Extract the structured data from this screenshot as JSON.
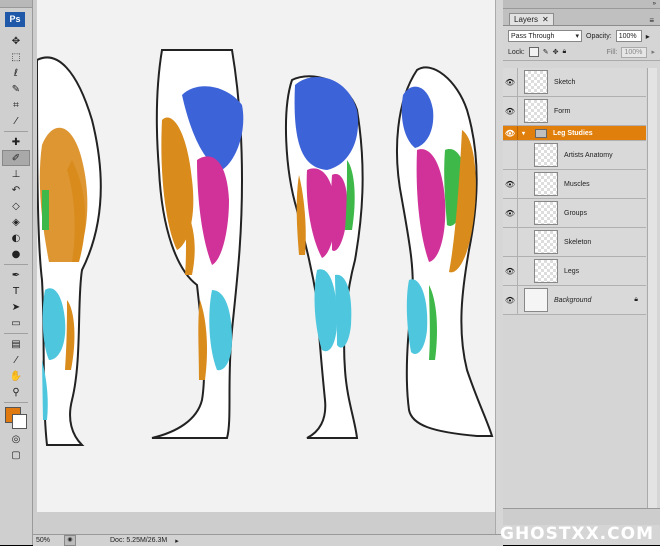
{
  "app": {
    "logo": "Ps"
  },
  "toolbar": {
    "tools": [
      {
        "name": "move-tool",
        "glyph": "✥"
      },
      {
        "name": "marquee-tool",
        "glyph": "⬚"
      },
      {
        "name": "lasso-tool",
        "glyph": "ℓ"
      },
      {
        "name": "quick-select-tool",
        "glyph": "✎"
      },
      {
        "name": "crop-tool",
        "glyph": "⌗"
      },
      {
        "name": "eyedropper-tool",
        "glyph": "⁄"
      },
      {
        "name": "healing-tool",
        "glyph": "✚"
      },
      {
        "name": "brush-tool",
        "glyph": "✐",
        "active": true
      },
      {
        "name": "clone-stamp-tool",
        "glyph": "⊥"
      },
      {
        "name": "history-brush-tool",
        "glyph": "↶"
      },
      {
        "name": "eraser-tool",
        "glyph": "◇"
      },
      {
        "name": "paint-bucket-tool",
        "glyph": "◈"
      },
      {
        "name": "blur-tool",
        "glyph": "◐"
      },
      {
        "name": "dodge-tool",
        "glyph": "●"
      },
      {
        "name": "pen-tool",
        "glyph": "✒"
      },
      {
        "name": "type-tool",
        "glyph": "T"
      },
      {
        "name": "path-select-tool",
        "glyph": "➤"
      },
      {
        "name": "shape-tool",
        "glyph": "▭"
      },
      {
        "name": "notes-tool",
        "glyph": "▤"
      },
      {
        "name": "eyedropper2-tool",
        "glyph": "⁄"
      },
      {
        "name": "hand-tool",
        "glyph": "✋"
      },
      {
        "name": "zoom-tool",
        "glyph": "⚲"
      }
    ],
    "foreground_color": "#e07a10",
    "background_color": "#ffffff",
    "quickmask_glyph": "◎",
    "screenmode_glyph": "▢"
  },
  "status": {
    "zoom": "50%",
    "doc": "Doc: 5.25M/26.3M",
    "arrow": "▸"
  },
  "layers_panel": {
    "tab": "Layers",
    "close": "✕",
    "menu": "≡",
    "collapse": "»",
    "blend_mode": "Pass Through",
    "opacity_label": "Opacity:",
    "opacity_value": "100%",
    "lock_label": "Lock:",
    "fill_label": "Fill:",
    "fill_value": "100%",
    "layers": [
      {
        "name": "Sketch",
        "visible": true,
        "type": "layer"
      },
      {
        "name": "Form",
        "visible": true,
        "type": "layer"
      },
      {
        "name": "Leg Studies",
        "visible": true,
        "type": "group"
      },
      {
        "name": "Artists Anatomy",
        "visible": false,
        "type": "child"
      },
      {
        "name": "Muscles",
        "visible": true,
        "type": "child"
      },
      {
        "name": "Groups",
        "visible": true,
        "type": "child"
      },
      {
        "name": "Skeleton",
        "visible": false,
        "type": "child"
      },
      {
        "name": "Legs",
        "visible": true,
        "type": "child"
      },
      {
        "name": "Background",
        "visible": true,
        "type": "background"
      }
    ]
  },
  "watermark": "GHOSTXX.COM",
  "colors": {
    "accent": "#e07f0c",
    "muscle_blue": "#3d63d8",
    "muscle_orange": "#d98b1c",
    "muscle_magenta": "#d0329a",
    "muscle_cyan": "#4ec7de",
    "muscle_green": "#3fb84a"
  }
}
